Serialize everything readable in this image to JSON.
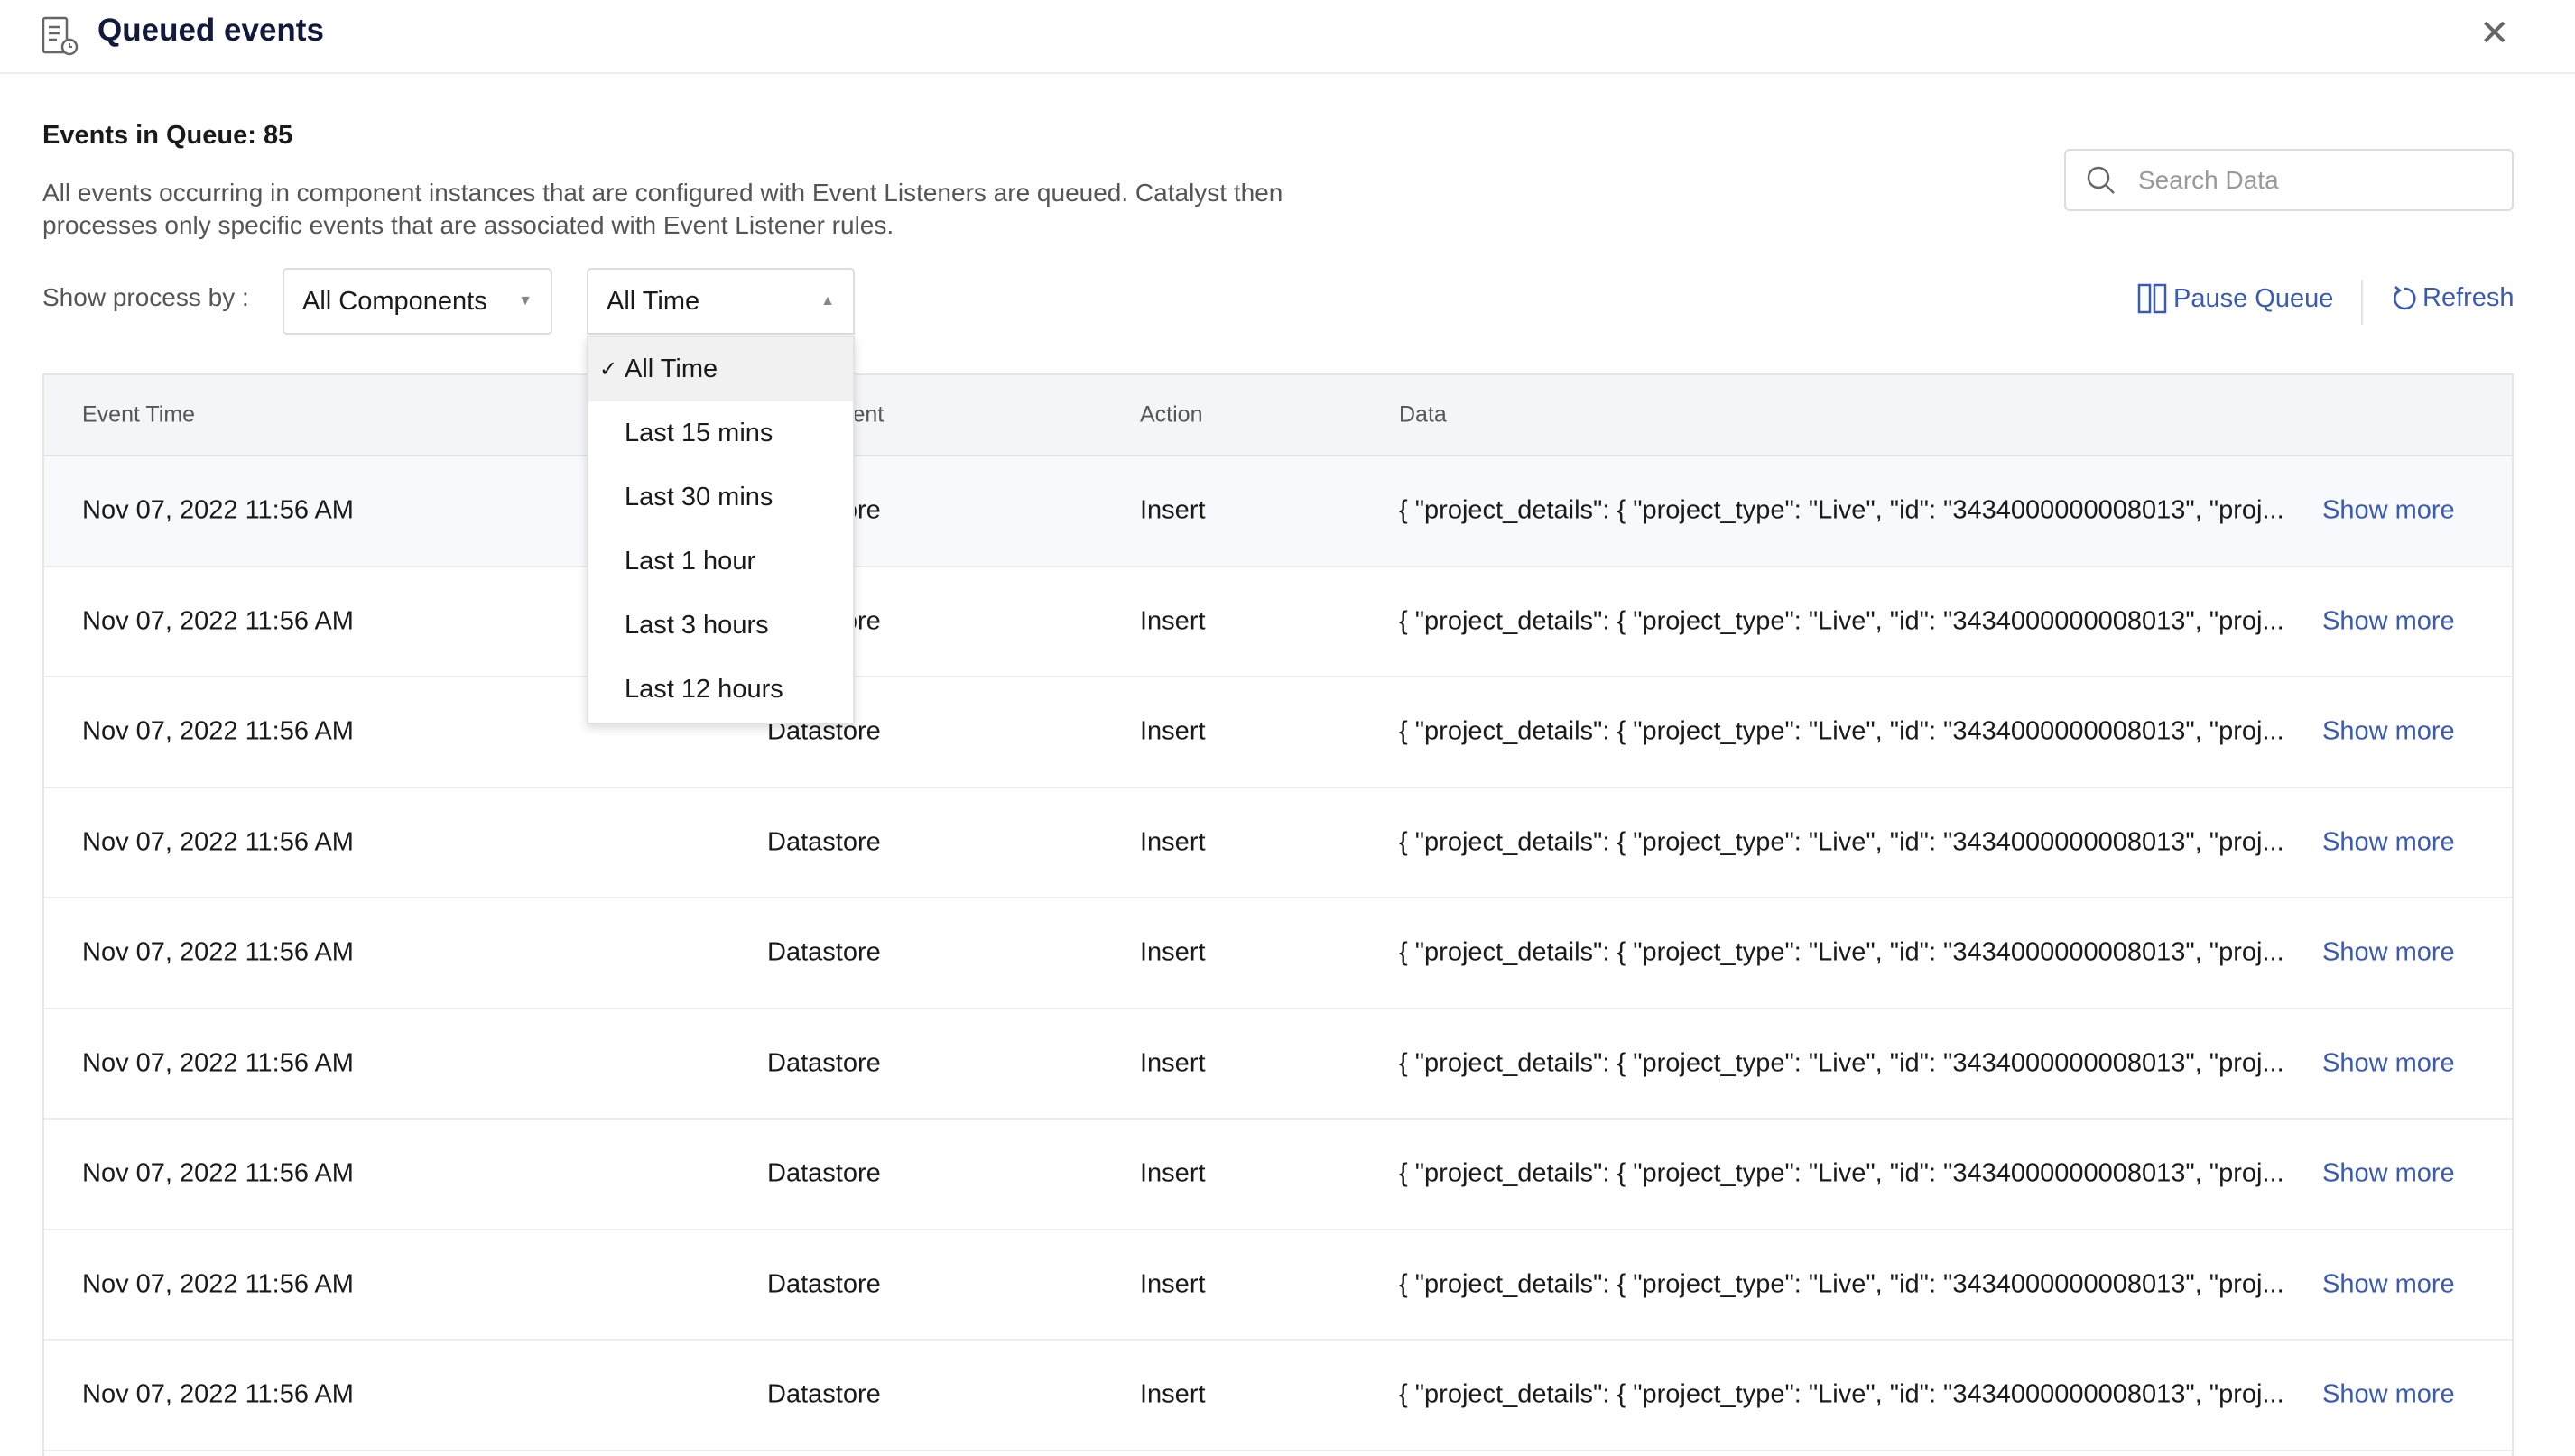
{
  "header": {
    "title": "Queued events",
    "icon": "queue-document-clock-icon",
    "close_icon": "close-icon"
  },
  "summary": {
    "count_label": "Events in Queue: 85",
    "description": "All events occurring in component instances that are configured with Event Listeners are queued. Catalyst then processes only specific events that are associated with Event Listener rules."
  },
  "filters": {
    "label": "Show process by :",
    "component_select": "All Components",
    "time_select": "All Time",
    "time_options": [
      "All Time",
      "Last 15 mins",
      "Last 30 mins",
      "Last 1 hour",
      "Last 3 hours",
      "Last 12 hours"
    ],
    "selected_index": 0
  },
  "search": {
    "placeholder": "Search Data"
  },
  "actions": {
    "pause": "Pause Queue",
    "refresh": "Refresh",
    "accent": "#3b5bb0"
  },
  "table": {
    "columns": [
      "Event Time",
      "Component",
      "Action",
      "Data"
    ],
    "show_more": "Show more",
    "rows": [
      {
        "time": "Nov 07, 2022 11:56 AM",
        "component": "Datastore",
        "action": "Insert",
        "data": "{ \"project_details\": { \"project_type\": \"Live\", \"id\": \"3434000000008013\", \"proj..."
      },
      {
        "time": "Nov 07, 2022 11:56 AM",
        "component": "Datastore",
        "action": "Insert",
        "data": "{ \"project_details\": { \"project_type\": \"Live\", \"id\": \"3434000000008013\", \"proj..."
      },
      {
        "time": "Nov 07, 2022 11:56 AM",
        "component": "Datastore",
        "action": "Insert",
        "data": "{ \"project_details\": { \"project_type\": \"Live\", \"id\": \"3434000000008013\", \"proj..."
      },
      {
        "time": "Nov 07, 2022 11:56 AM",
        "component": "Datastore",
        "action": "Insert",
        "data": "{ \"project_details\": { \"project_type\": \"Live\", \"id\": \"3434000000008013\", \"proj..."
      },
      {
        "time": "Nov 07, 2022 11:56 AM",
        "component": "Datastore",
        "action": "Insert",
        "data": "{ \"project_details\": { \"project_type\": \"Live\", \"id\": \"3434000000008013\", \"proj..."
      },
      {
        "time": "Nov 07, 2022 11:56 AM",
        "component": "Datastore",
        "action": "Insert",
        "data": "{ \"project_details\": { \"project_type\": \"Live\", \"id\": \"3434000000008013\", \"proj..."
      },
      {
        "time": "Nov 07, 2022 11:56 AM",
        "component": "Datastore",
        "action": "Insert",
        "data": "{ \"project_details\": { \"project_type\": \"Live\", \"id\": \"3434000000008013\", \"proj..."
      },
      {
        "time": "Nov 07, 2022 11:56 AM",
        "component": "Datastore",
        "action": "Insert",
        "data": "{ \"project_details\": { \"project_type\": \"Live\", \"id\": \"3434000000008013\", \"proj..."
      },
      {
        "time": "Nov 07, 2022 11:56 AM",
        "component": "Datastore",
        "action": "Insert",
        "data": "{ \"project_details\": { \"project_type\": \"Live\", \"id\": \"3434000000008013\", \"proj..."
      }
    ]
  }
}
